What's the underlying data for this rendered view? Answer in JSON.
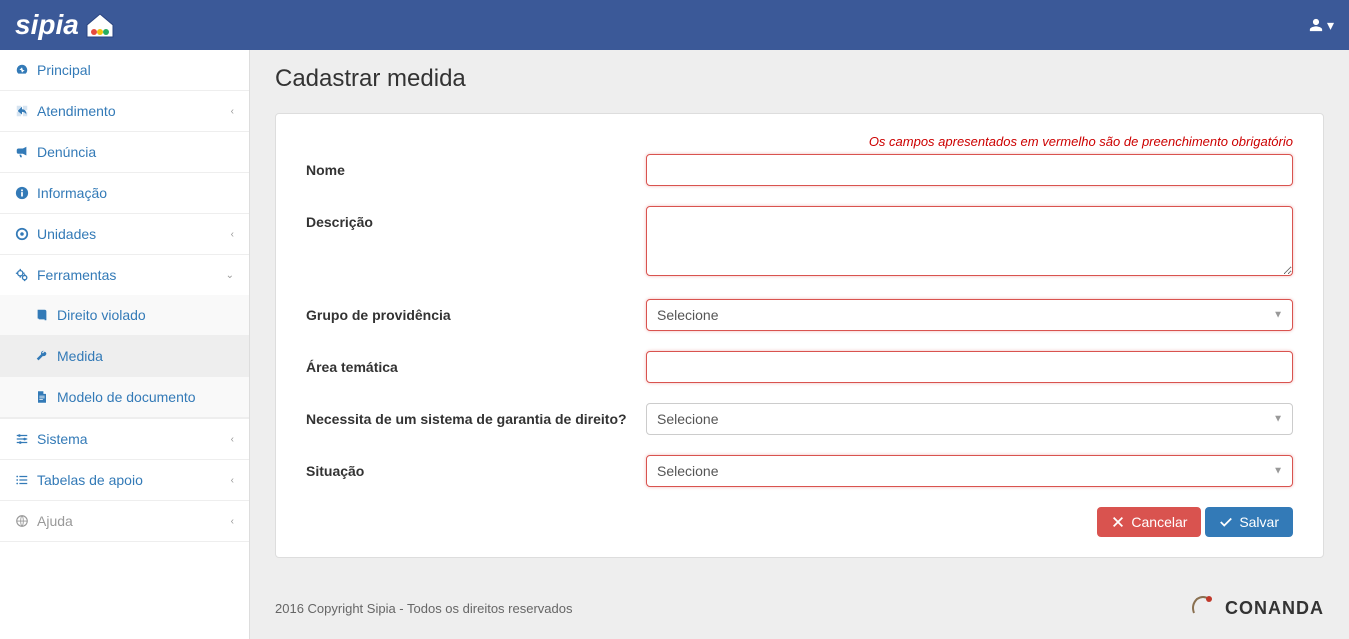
{
  "app": {
    "name": "sipia"
  },
  "user_menu": {
    "label": ""
  },
  "sidebar": {
    "items": [
      {
        "label": "Principal",
        "icon": "dashboard-icon",
        "expandable": false
      },
      {
        "label": "Atendimento",
        "icon": "share-icon",
        "expandable": true
      },
      {
        "label": "Denúncia",
        "icon": "bullhorn-icon",
        "expandable": false
      },
      {
        "label": "Informação",
        "icon": "info-icon",
        "expandable": false
      },
      {
        "label": "Unidades",
        "icon": "circle-dot-icon",
        "expandable": true
      },
      {
        "label": "Ferramentas",
        "icon": "cogs-icon",
        "expandable": true,
        "expanded": true,
        "children": [
          {
            "label": "Direito violado",
            "icon": "book-icon"
          },
          {
            "label": "Medida",
            "icon": "wrench-icon",
            "active": true
          },
          {
            "label": "Modelo de documento",
            "icon": "file-icon"
          }
        ]
      },
      {
        "label": "Sistema",
        "icon": "sliders-icon",
        "expandable": true
      },
      {
        "label": "Tabelas de apoio",
        "icon": "list-icon",
        "expandable": true
      },
      {
        "label": "Ajuda",
        "icon": "globe-icon",
        "expandable": true,
        "disabled": true
      }
    ]
  },
  "page": {
    "title": "Cadastrar medida",
    "required_note": "Os campos apresentados em vermelho são de preenchimento obrigatório"
  },
  "form": {
    "nome": {
      "label": "Nome",
      "value": ""
    },
    "descricao": {
      "label": "Descrição",
      "value": ""
    },
    "grupo": {
      "label": "Grupo de providência",
      "placeholder": "Selecione"
    },
    "area": {
      "label": "Área temática",
      "value": ""
    },
    "garantia": {
      "label": "Necessita de um sistema de garantia de direito?",
      "placeholder": "Selecione"
    },
    "situacao": {
      "label": "Situação",
      "placeholder": "Selecione"
    }
  },
  "buttons": {
    "cancel": "Cancelar",
    "save": "Salvar"
  },
  "footer": {
    "copyright": "2016 Copyright Sipia - Todos os direitos reservados",
    "brand": "CONANDA"
  }
}
